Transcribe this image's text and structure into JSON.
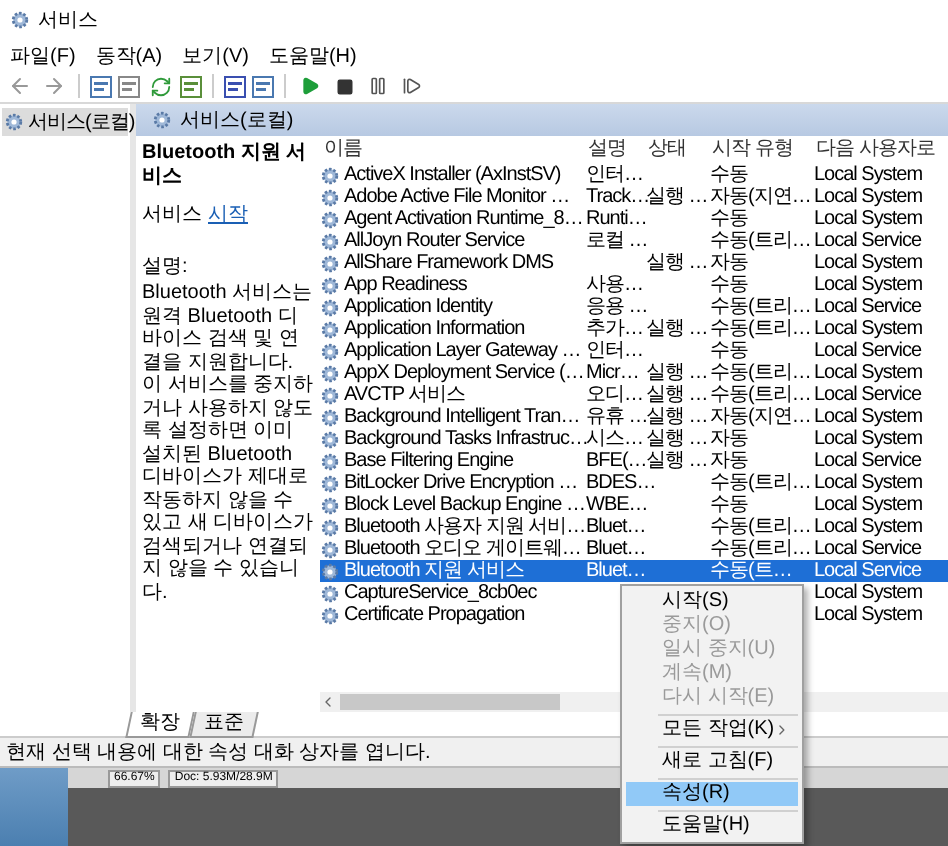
{
  "window": {
    "title": "서비스"
  },
  "menu": [
    "파일(F)",
    "동작(A)",
    "보기(V)",
    "도움말(H)"
  ],
  "tree": [
    {
      "label": "서비스(로컬)",
      "selected": true
    }
  ],
  "panel_title": "서비스(로컬)",
  "details": {
    "title": "Bluetooth 지원 서비스",
    "action_prefix": "서비스",
    "action_link": "시작",
    "description_label": "설명:",
    "description": "Bluetooth 서비스는 원격 Bluetooth 디바이스 검색 및 연결을 지원합니다. 이 서비스를 중지하거나 사용하지 않도록 설정하면 이미 설치된 Bluetooth 디바이스가 제대로 작동하지 않을 수 있고 새 디바이스가 검색되거나 연결되지 않을 수 있습니다."
  },
  "table": {
    "columns": [
      "이름",
      "설명",
      "상태",
      "시작 유형",
      "다음 사용자로"
    ],
    "rows": [
      {
        "name": "ActiveX Installer (AxInstSV)",
        "description": "인터…",
        "startup": "수동",
        "logon": "Local System",
        "selected": false
      },
      {
        "name": "Adobe Active File Monitor …",
        "description": "Track…",
        "status": "실행 …",
        "startup": "자동(지연…",
        "logon": "Local System",
        "selected": false
      },
      {
        "name": "Agent Activation Runtime_8…",
        "description": "Runti…",
        "startup": "수동",
        "logon": "Local System",
        "selected": false
      },
      {
        "name": "AllJoyn Router Service",
        "description": "로컬 …",
        "startup": "수동(트리…",
        "logon": "Local Service",
        "selected": false
      },
      {
        "name": "AllShare Framework DMS",
        "status": "실행 …",
        "startup": "자동",
        "logon": "Local System",
        "selected": false
      },
      {
        "name": "App Readiness",
        "description": "사용…",
        "startup": "수동",
        "logon": "Local System",
        "selected": false
      },
      {
        "name": "Application Identity",
        "description": "응용 …",
        "startup": "수동(트리…",
        "logon": "Local Service",
        "selected": false
      },
      {
        "name": "Application Information",
        "description": "추가…",
        "status": "실행 …",
        "startup": "수동(트리…",
        "logon": "Local System",
        "selected": false
      },
      {
        "name": "Application Layer Gateway …",
        "description": "인터…",
        "startup": "수동",
        "logon": "Local Service",
        "selected": false
      },
      {
        "name": "AppX Deployment Service (…",
        "description": "Micr…",
        "status": "실행 …",
        "startup": "수동(트리…",
        "logon": "Local System",
        "selected": false
      },
      {
        "name": "AVCTP 서비스",
        "description": "오디…",
        "status": "실행 …",
        "startup": "수동(트리…",
        "logon": "Local Service",
        "selected": false
      },
      {
        "name": "Background Intelligent Tran…",
        "description": "유휴 …",
        "status": "실행 …",
        "startup": "자동(지연…",
        "logon": "Local System",
        "selected": false
      },
      {
        "name": "Background Tasks Infrastruc…",
        "description": "시스…",
        "status": "실행 …",
        "startup": "자동",
        "logon": "Local System",
        "selected": false
      },
      {
        "name": "Base Filtering Engine",
        "description": "BFE(…",
        "status": "실행 …",
        "startup": "자동",
        "logon": "Local Service",
        "selected": false
      },
      {
        "name": "BitLocker Drive Encryption …",
        "description": "BDES…",
        "startup": "수동(트리…",
        "logon": "Local System",
        "selected": false
      },
      {
        "name": "Block Level Backup Engine …",
        "description": "WBE…",
        "startup": "수동",
        "logon": "Local System",
        "selected": false
      },
      {
        "name": "Bluetooth 사용자 지원 서비…",
        "description": "Bluet…",
        "startup": "수동(트리…",
        "logon": "Local System",
        "selected": false
      },
      {
        "name": "Bluetooth 오디오 게이트웨…",
        "description": "Bluet…",
        "startup": "수동(트리…",
        "logon": "Local Service",
        "selected": false
      },
      {
        "name": "Bluetooth 지원 서비스",
        "description": "Bluet…",
        "startup": "수동(트…",
        "logon": "Local Service",
        "selected": true
      },
      {
        "name": "CaptureService_8cb0ec",
        "logon": "Local System",
        "selected": false
      },
      {
        "name": "Certificate Propagation",
        "logon": "Local System",
        "selected": false
      }
    ]
  },
  "view_tabs": [
    {
      "label": "확장",
      "selected": true
    },
    {
      "label": "표준",
      "selected": false
    }
  ],
  "status_bar": "현재 선택 내용에 대한 속성 대화 상자를 엽니다.",
  "context_menu": [
    {
      "kind": "item",
      "label": "시작(S)",
      "disabled": false,
      "highlighted": false,
      "submenu": false
    },
    {
      "kind": "item",
      "label": "중지(O)",
      "disabled": true,
      "highlighted": false,
      "submenu": false
    },
    {
      "kind": "item",
      "label": "일시 중지(U)",
      "disabled": true,
      "highlighted": false,
      "submenu": false
    },
    {
      "kind": "item",
      "label": "계속(M)",
      "disabled": true,
      "highlighted": false,
      "submenu": false
    },
    {
      "kind": "item",
      "label": "다시 시작(E)",
      "disabled": true,
      "highlighted": false,
      "submenu": false
    },
    {
      "kind": "separator"
    },
    {
      "kind": "item",
      "label": "모든 작업(K)",
      "disabled": false,
      "highlighted": false,
      "submenu": true
    },
    {
      "kind": "separator"
    },
    {
      "kind": "item",
      "label": "새로 고침(F)",
      "disabled": false,
      "highlighted": false,
      "submenu": false
    },
    {
      "kind": "separator"
    },
    {
      "kind": "item",
      "label": "속성(R)",
      "disabled": false,
      "highlighted": true,
      "submenu": false
    },
    {
      "kind": "separator"
    },
    {
      "kind": "item",
      "label": "도움말(H)",
      "disabled": false,
      "highlighted": false,
      "submenu": false
    }
  ],
  "background_app": {
    "zoom": "66.67%",
    "doc": "Doc: 5.93M/28.9M"
  }
}
